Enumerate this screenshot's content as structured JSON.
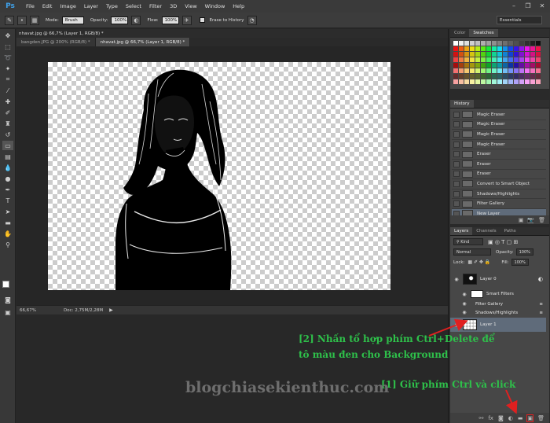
{
  "app": {
    "logo": "Ps"
  },
  "menu": [
    "File",
    "Edit",
    "Image",
    "Layer",
    "Type",
    "Select",
    "Filter",
    "3D",
    "View",
    "Window",
    "Help"
  ],
  "options": {
    "mode_label": "Mode:",
    "mode_value": "Brush",
    "opacity_label": "Opacity:",
    "opacity_value": "100%",
    "flow_label": "Flow:",
    "flow_value": "100%",
    "erase_history": "Erase to History",
    "workspace": "Essentials"
  },
  "document": {
    "title": "nhavat.jpg @ 66,7% (Layer 1, RGB/8) *",
    "tabs": [
      "bangden.JPG @ 200% (RGB/8) *",
      "nhavat.jpg @ 66,7% (Layer 1, RGB/8) *"
    ],
    "zoom": "66,67%",
    "doc_info": "Doc: 2,75M/2,28M"
  },
  "panels": {
    "color_tabs": [
      "Color",
      "Swatches"
    ],
    "history_title": "History",
    "history_items": [
      "Magic Eraser",
      "Magic Eraser",
      "Magic Eraser",
      "Magic Eraser",
      "Eraser",
      "Eraser",
      "Eraser",
      "Convert to Smart Object",
      "Shadows/Highlights",
      "Filter Gallery",
      "New Layer"
    ],
    "layers_tabs": [
      "Layers",
      "Channels",
      "Paths"
    ],
    "kind_label": "Kind",
    "blend_mode": "Normal",
    "opacity_label": "Opacity:",
    "opacity_value": "100%",
    "lock_label": "Lock:",
    "fill_label": "Fill:",
    "fill_value": "100%",
    "layers": {
      "layer0": "Layer 0",
      "smart_filters": "Smart Filters",
      "filter_gallery": "Filter Gallery",
      "shadows": "Shadows/Highlights",
      "layer1": "Layer 1"
    }
  },
  "annotations": {
    "line1": "[2] Nhấn tổ hợp phím Ctrl+Delete để",
    "line2": "tô màu đen cho Background",
    "step1": "[1] Giữ phím Ctrl và click",
    "watermark": "blogchiasekienthuc.com"
  },
  "colors": {
    "annotation_green": "#2ec04a",
    "arrow_red": "#e02020",
    "selection_blue": "#5f6b7a"
  }
}
